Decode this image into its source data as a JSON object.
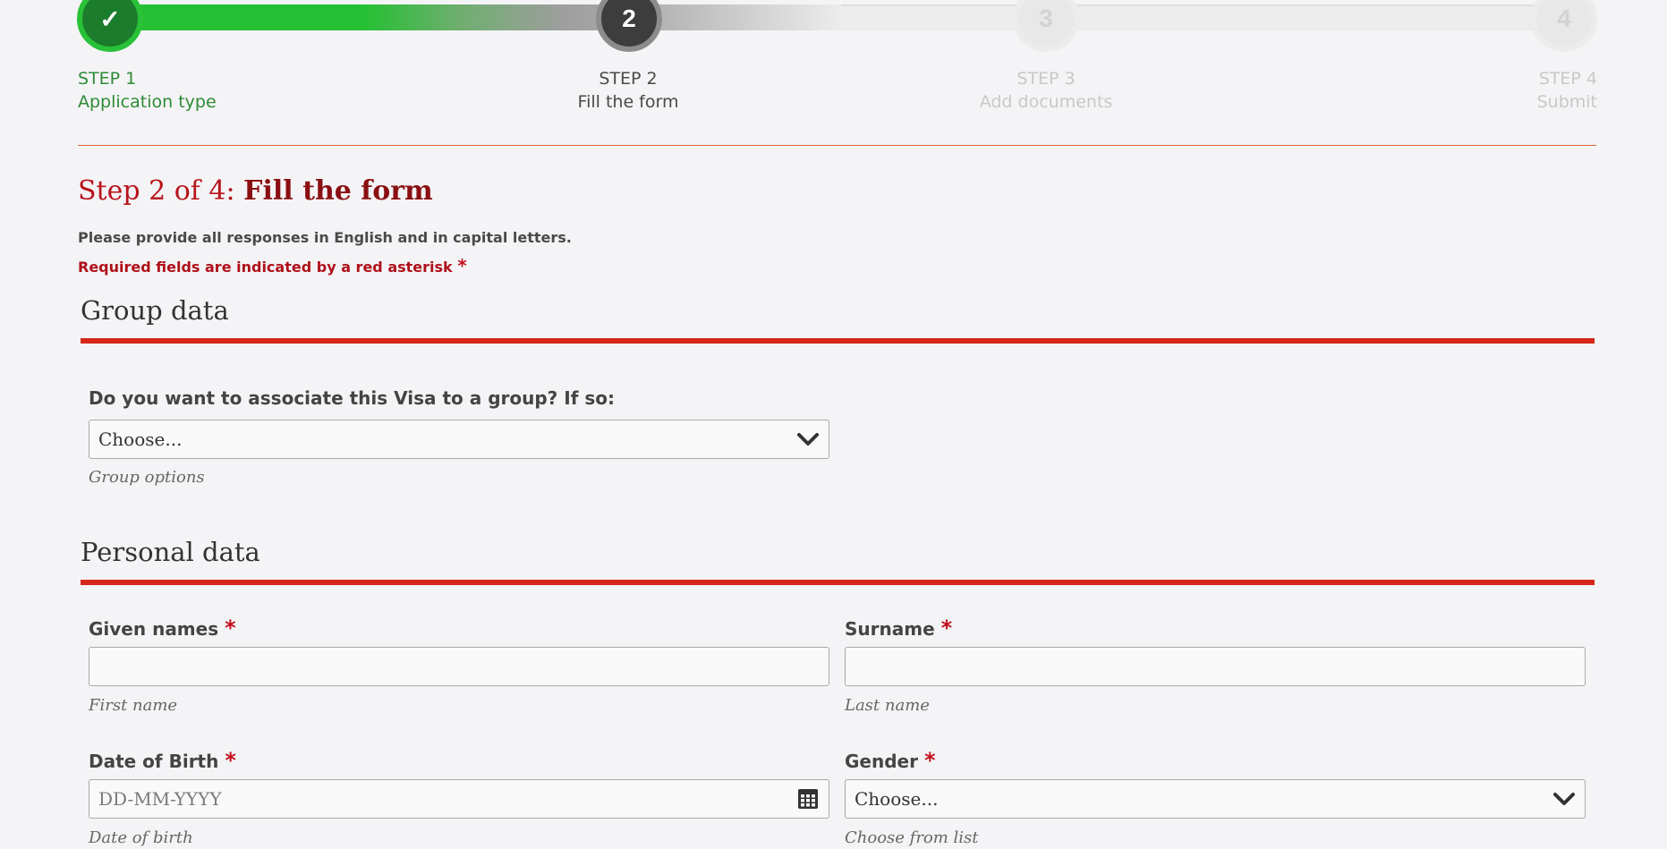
{
  "stepper": {
    "steps": [
      {
        "number": "STEP 1",
        "name": "Application type",
        "badge": "✓",
        "state": "done"
      },
      {
        "number": "STEP 2",
        "name": "Fill the form",
        "badge": "2",
        "state": "active"
      },
      {
        "number": "STEP 3",
        "name": "Add documents",
        "badge": "3",
        "state": "pending"
      },
      {
        "number": "STEP 4",
        "name": "Submit",
        "badge": "4",
        "state": "pending"
      }
    ]
  },
  "heading": {
    "prefix": "Step 2 of 4:",
    "title": "Fill the form"
  },
  "notices": {
    "language": "Please provide all responses in English and in capital letters.",
    "required": "Required fields are indicated by a red asterisk",
    "asterisk": "*"
  },
  "group_section": {
    "title": "Group data",
    "question": "Do you want to associate this Visa to a group? If so:",
    "select_value": "Choose...",
    "help": "Group options"
  },
  "personal_section": {
    "title": "Personal data",
    "given_names": {
      "label": "Given names",
      "required": "*",
      "value": "",
      "help": "First name"
    },
    "surname": {
      "label": "Surname",
      "required": "*",
      "value": "",
      "help": "Last name"
    },
    "dob": {
      "label": "Date of Birth",
      "required": "*",
      "placeholder": "DD-MM-YYYY",
      "help": "Date of birth"
    },
    "gender": {
      "label": "Gender",
      "required": "*",
      "select_value": "Choose...",
      "help": "Choose from list"
    }
  },
  "colors": {
    "progress_green": "#25c033",
    "accent_red": "#d7261a",
    "heading_red": "#b8141b"
  },
  "icons": {
    "step1": "checkmark-icon",
    "select": "chevron-down-icon",
    "date": "calendar-icon"
  }
}
